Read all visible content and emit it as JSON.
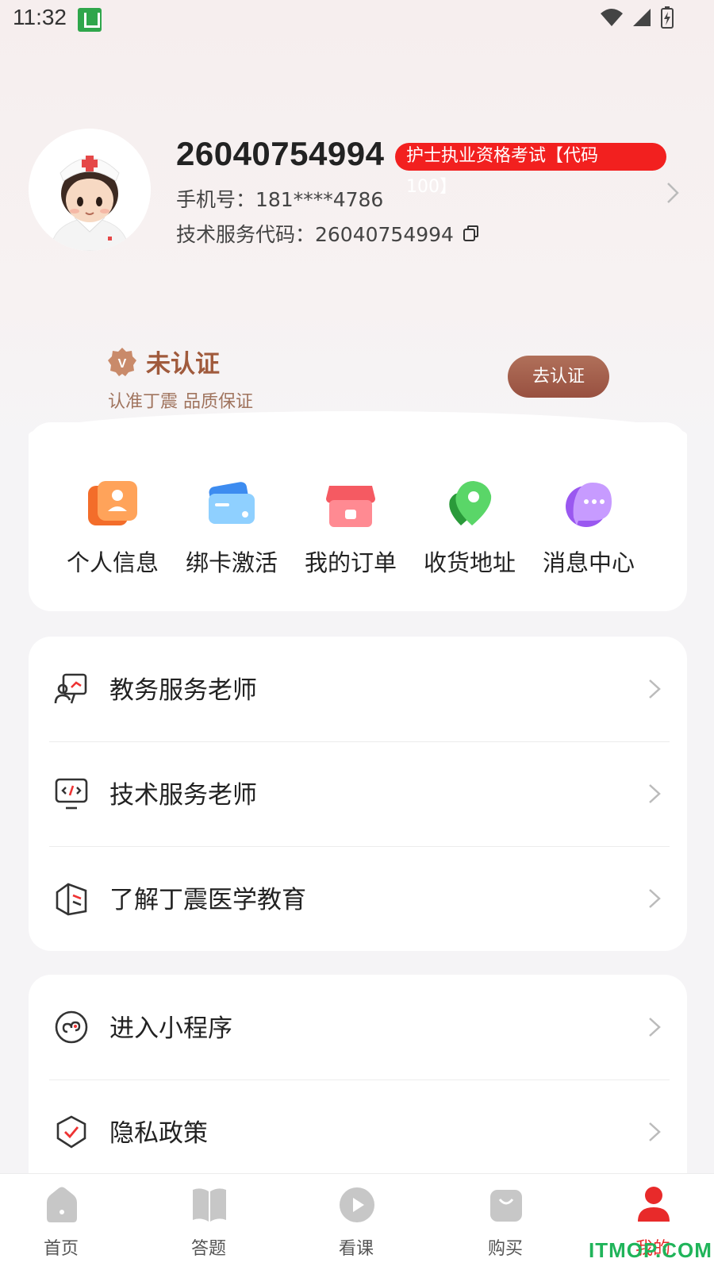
{
  "status_bar": {
    "time": "11:32"
  },
  "profile": {
    "username": "26040754994",
    "exam_badge": "护士执业资格考试【代码",
    "exam_badge_overflow": "100】",
    "phone": "手机号：181****4786",
    "service_code": "技术服务代码：26040754994"
  },
  "verify": {
    "title": "未认证",
    "subtitle": "认准丁震 品质保证",
    "button": "去认证"
  },
  "quick_actions": [
    {
      "label": "个人信息",
      "icon": "id-card-icon"
    },
    {
      "label": "绑卡激活",
      "icon": "card-icon"
    },
    {
      "label": "我的订单",
      "icon": "shop-icon"
    },
    {
      "label": "收货地址",
      "icon": "location-pin-icon"
    },
    {
      "label": "消息中心",
      "icon": "chat-bubble-icon"
    }
  ],
  "service_list": [
    {
      "label": "教务服务老师",
      "icon": "teacher-board-icon"
    },
    {
      "label": "技术服务老师",
      "icon": "code-monitor-icon"
    },
    {
      "label": "了解丁震医学教育",
      "icon": "brand-cube-icon"
    }
  ],
  "other_list": [
    {
      "label": "进入小程序",
      "icon": "mini-program-icon"
    },
    {
      "label": "隐私政策",
      "icon": "shield-check-icon"
    }
  ],
  "bottom_nav": [
    {
      "label": "首页",
      "icon": "home-icon",
      "active": false
    },
    {
      "label": "答题",
      "icon": "book-icon",
      "active": false
    },
    {
      "label": "看课",
      "icon": "play-icon",
      "active": false
    },
    {
      "label": "购买",
      "icon": "bag-icon",
      "active": false
    },
    {
      "label": "我的",
      "icon": "user-icon",
      "active": true
    }
  ],
  "colors": {
    "accent": "#e82a2a",
    "verify_brown": "#a05a3c",
    "badge_red": "#f2201f"
  },
  "watermark": "ITMOP.COM"
}
